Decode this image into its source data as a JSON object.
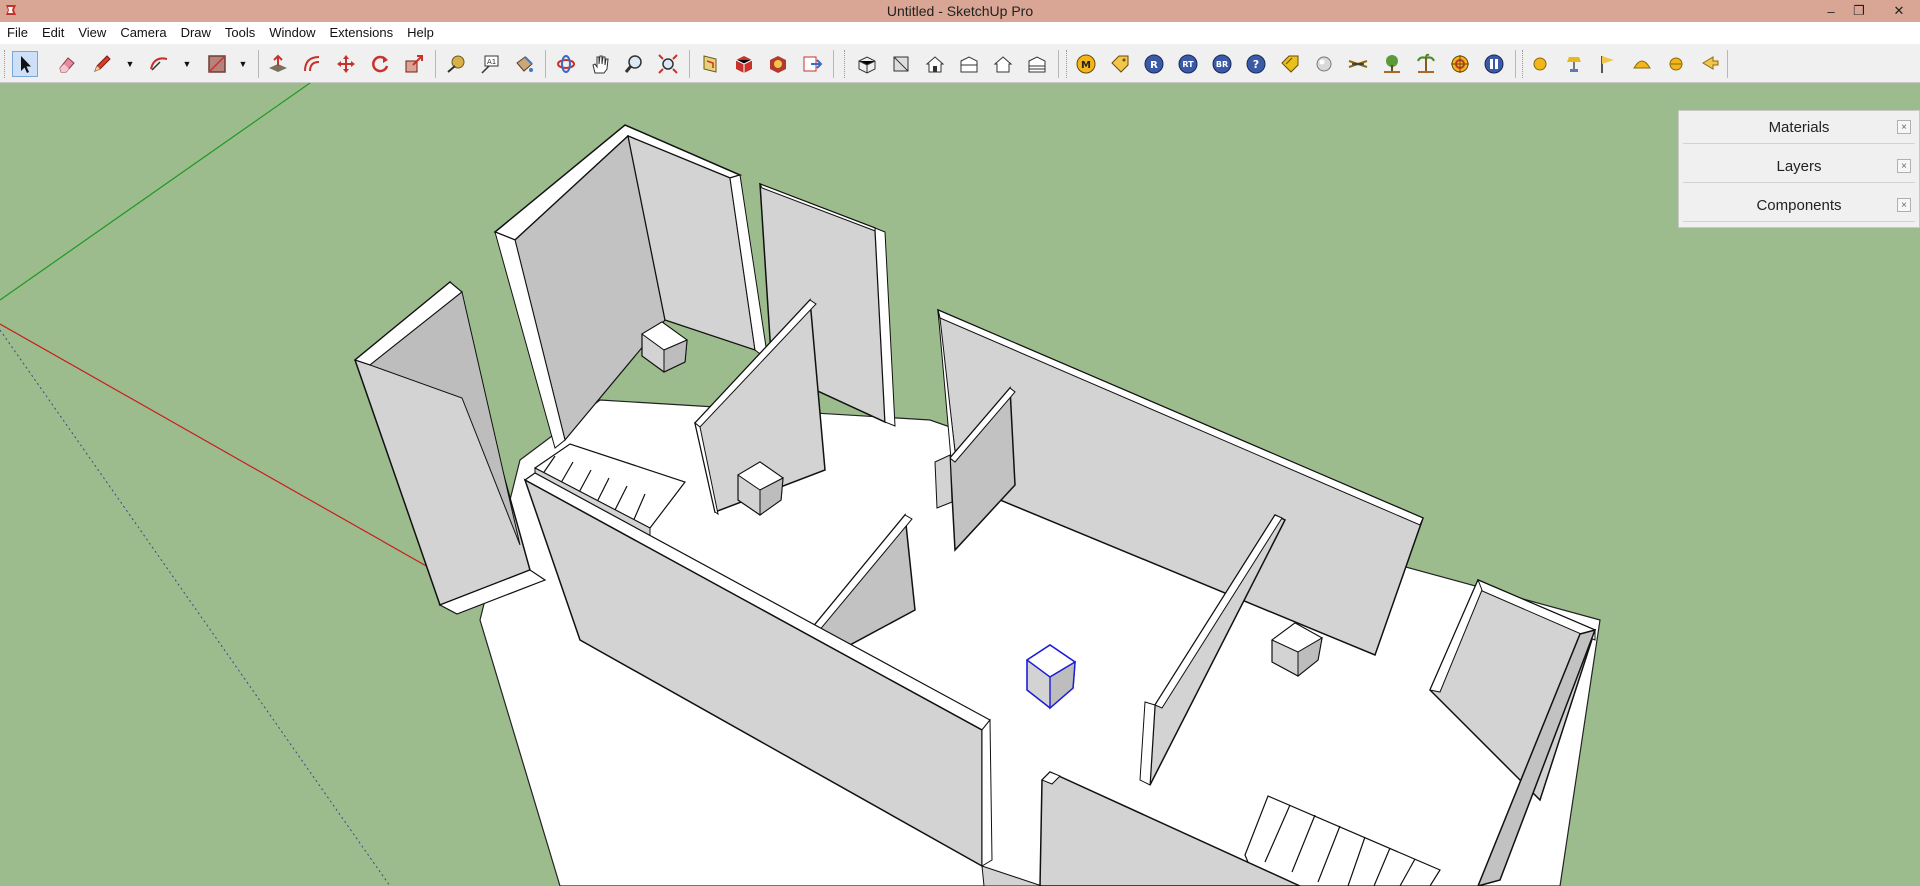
{
  "window": {
    "title": "Untitled - SketchUp Pro",
    "controls": [
      "minimize-icon",
      "restore-icon",
      "close-icon"
    ]
  },
  "menubar": {
    "items": [
      "File",
      "Edit",
      "View",
      "Camera",
      "Draw",
      "Tools",
      "Window",
      "Extensions",
      "Help"
    ]
  },
  "toolbar": {
    "active_tool": "select-tool-icon",
    "plugin_labels": [
      "M",
      "R",
      "RT",
      "BR",
      "?"
    ],
    "groups": [
      [
        "select-tool-icon",
        "eraser-icon",
        "pencil-line-icon",
        "arc-icon",
        "rectangle-icon"
      ],
      [
        "push-pull-icon",
        "offset-icon",
        "move-icon",
        "rotate-icon",
        "scale-icon"
      ],
      [
        "tape-measure-icon",
        "dimension-icon",
        "paint-bucket-icon"
      ],
      [
        "orbit-icon",
        "pan-hand-icon",
        "zoom-icon",
        "zoom-extents-icon"
      ],
      [
        "section-plane-icon",
        "3d-warehouse-icon",
        "extension-warehouse-icon",
        "send-to-layout-icon"
      ],
      [
        "iso-view-icon",
        "top-view-icon",
        "front-view-icon",
        "right-view-icon",
        "back-view-icon",
        "left-view-icon"
      ],
      [
        "plugin-m-icon",
        "tag-icon",
        "plugin-r-icon",
        "plugin-rt-icon",
        "plugin-br-icon",
        "help-icon",
        "tag-yellow-icon",
        "sphere-icon",
        "bridge-icon",
        "tree-icon",
        "palm-tree-icon",
        "target-icon",
        "pause-icon"
      ],
      [
        "sun-sphere-icon",
        "lamp-icon",
        "flag-icon",
        "dome-icon",
        "half-sphere-icon",
        "pointer-icon"
      ]
    ]
  },
  "tray": {
    "panels": [
      {
        "label": "Materials",
        "close": "×"
      },
      {
        "label": "Layers",
        "close": "×"
      },
      {
        "label": "Components",
        "close": "×"
      }
    ]
  },
  "colors": {
    "viewport_background": "#9cbc8e",
    "title_bar": "#d9a594",
    "wall_face": "#d3d3d3",
    "wall_top": "#ffffff",
    "floor": "#ffffff",
    "red_axis": "#c81e1e",
    "green_axis": "#1e9a1e",
    "selection": "#1d1dd8"
  }
}
